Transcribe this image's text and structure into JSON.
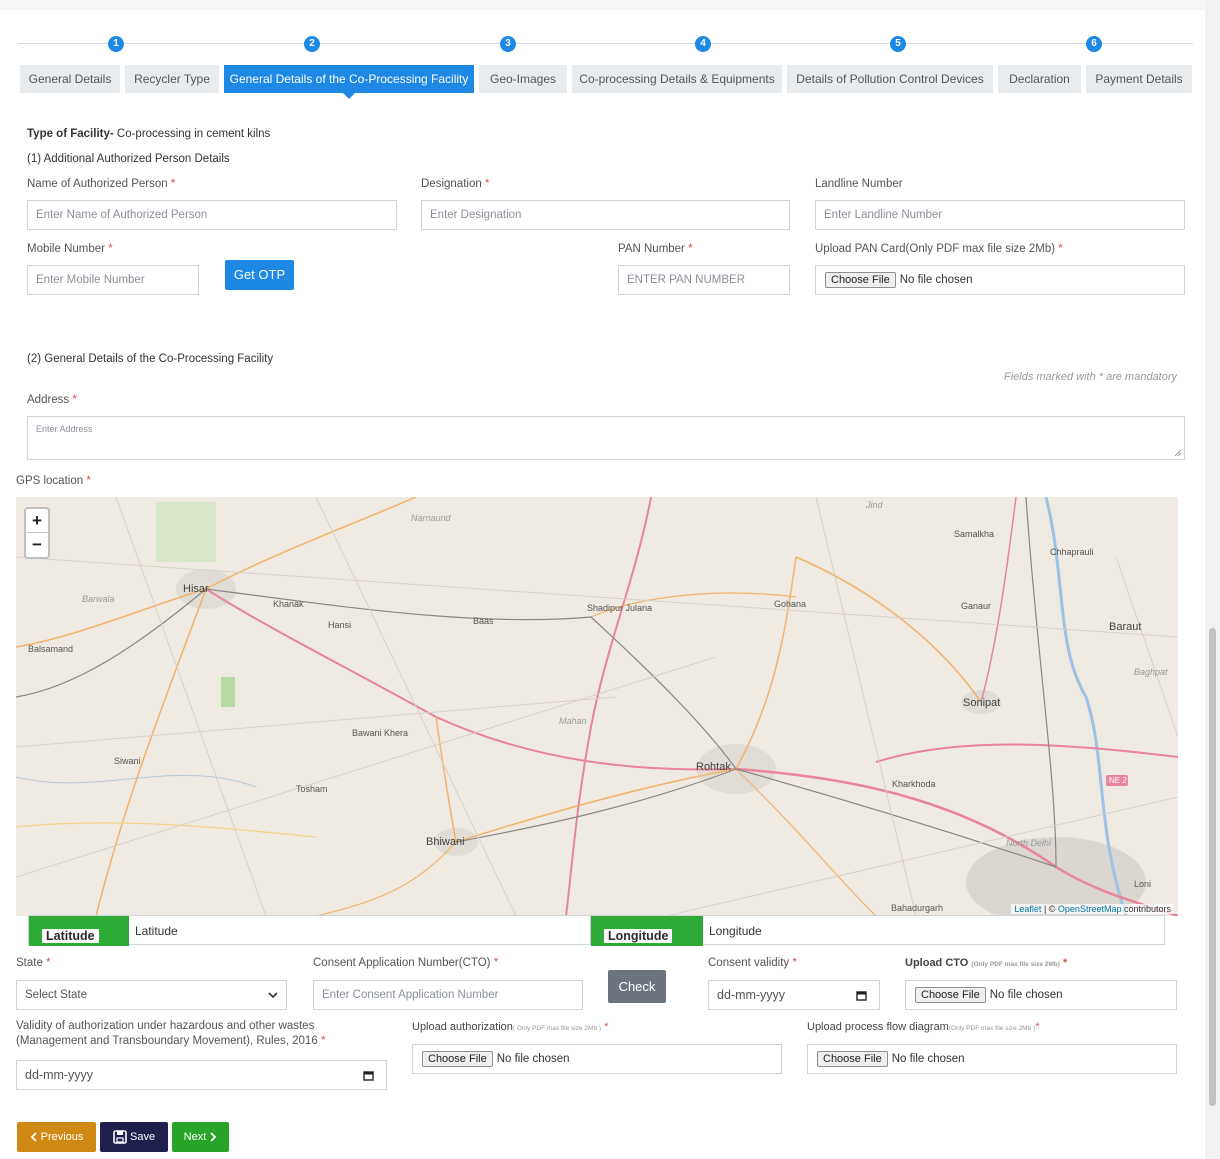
{
  "stepper": {
    "steps": [
      "1",
      "2",
      "3",
      "4",
      "5",
      "6"
    ]
  },
  "tabs": [
    {
      "label": "General Details"
    },
    {
      "label": "Recycler Type"
    },
    {
      "label": "General Details of the Co-Processing Facility"
    },
    {
      "label": "Geo-Images"
    },
    {
      "label": "Co-processing Details & Equipments"
    },
    {
      "label": "Details of Pollution Control Devices"
    },
    {
      "label": "Declaration"
    },
    {
      "label": "Payment Details"
    }
  ],
  "facility": {
    "type_label": "Type of Facility-",
    "type_value": "Co-processing in cement kilns"
  },
  "section1": {
    "title": "(1) Additional Authorized Person Details",
    "name_label": "Name of Authorized Person",
    "name_placeholder": "Enter Name of Authorized Person",
    "designation_label": "Designation",
    "designation_placeholder": "Enter Designation",
    "landline_label": "Landline Number",
    "landline_placeholder": "Enter Landline Number",
    "mobile_label": "Mobile Number",
    "mobile_placeholder": "Enter Mobile Number",
    "otp_button": "Get OTP",
    "pan_label": "PAN Number",
    "pan_placeholder": "ENTER PAN NUMBER",
    "pan_card_label": "Upload PAN Card(Only PDF max file size 2Mb)",
    "choose_file": "Choose File",
    "no_file": "No file chosen"
  },
  "section2": {
    "title": "(2) General Details of the Co-Processing Facility",
    "mandatory_note": "Fields marked with * are mandatory",
    "address_label": "Address",
    "address_placeholder": "Enter Address",
    "gps_label": "GPS location"
  },
  "required_mark": "*",
  "map": {
    "zoom_in": "+",
    "zoom_out": "−",
    "attribution_leaflet": "Leaflet",
    "attribution_sep": " | © ",
    "attribution_osm": "OpenStreetMap",
    "attribution_tail": " contributors",
    "places": [
      "Hisar",
      "Barwala",
      "Narnaund",
      "Jind",
      "Samalkha",
      "Chhaprauli",
      "Khanak",
      "Hansi",
      "Baas",
      "Shadipur Julana",
      "Gohana",
      "Ganaur",
      "Baraut",
      "Balsamand",
      "Sonipat",
      "Baghpat",
      "Mahan",
      "Bawani Khera",
      "Siwani",
      "Tosham",
      "Rohtak",
      "Kharkhoda",
      "Bhiwani",
      "Bahadurgarh",
      "North Delhi",
      "Loni",
      "NE 2"
    ]
  },
  "coords": {
    "lat_tag": "Latitude",
    "lat_value": "Latitude",
    "lng_tag": "Longitude",
    "lng_value": "Longitude"
  },
  "lower": {
    "state_label": "State",
    "state_value": "Select State",
    "cto_label": "Consent Application Number(CTO)",
    "cto_placeholder": "Enter Consent Application Number",
    "check_button": "Check",
    "validity_label": "Consent validity",
    "validity_placeholder": "dd-mm-yyyy",
    "upload_cto_label": "Upload CTO",
    "upload_cto_note": "(Only PDF max file size 2Mb)",
    "auth_validity_label_1": "Validity of authorization under hazardous and other wastes",
    "auth_validity_label_2": "(Management and Transboundary Movement), Rules, 2016",
    "auth_validity_placeholder": "dd-mm-yyyy",
    "upload_auth_label": "Upload authorization",
    "upload_auth_note": "( Only PDF max file size 2Mb )",
    "upload_flow_label": "Upload process flow diagram",
    "upload_flow_note": "(Only PDF max file size 2Mb )"
  },
  "actions": {
    "previous": "Previous",
    "save": "Save",
    "next": "Next"
  }
}
